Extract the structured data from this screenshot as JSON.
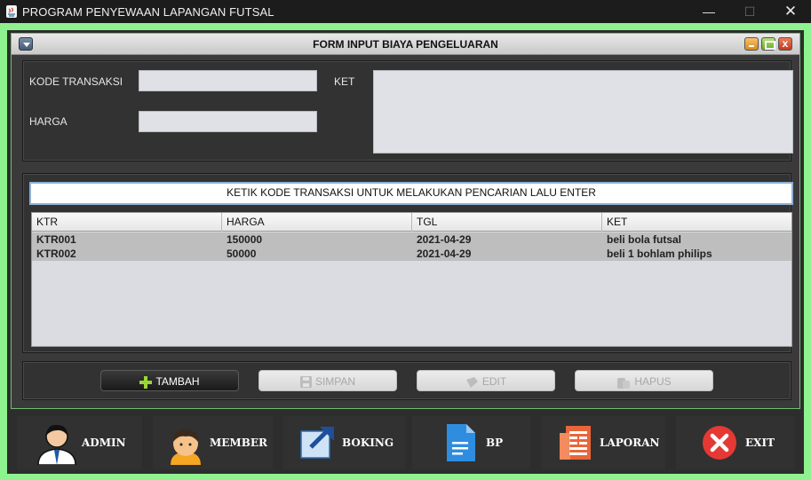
{
  "window": {
    "title": "PROGRAM PENYEWAAN LAPANGAN FUTSAL",
    "minimize": "—",
    "maximize": "☐",
    "close": "✕"
  },
  "form": {
    "title": "FORM INPUT BIAYA PENGELUARAN",
    "close": "x",
    "fields": {
      "kode_label": "KODE TRANSAKSI",
      "kode_value": "",
      "harga_label": "HARGA",
      "harga_value": "",
      "ket_label": "KET",
      "ket_value": ""
    },
    "search": {
      "value": "KETIK KODE TRANSAKSI UNTUK MELAKUKAN PENCARIAN LALU ENTER"
    },
    "table": {
      "columns": [
        "KTR",
        "HARGA",
        "TGL",
        "KET"
      ],
      "rows": [
        [
          "KTR001",
          "150000",
          "2021-04-29",
          "beli bola futsal"
        ],
        [
          "KTR002",
          "50000",
          "2021-04-29",
          "beli 1 bohlam philips"
        ]
      ]
    },
    "buttons": {
      "tambah": "TAMBAH",
      "simpan": "SIMPAN",
      "edit": "EDIT",
      "hapus": "HAPUS"
    }
  },
  "nav": {
    "admin": "ADMIN",
    "member": "MEMBER",
    "boking": "BOKING",
    "bp": "BP",
    "laporan": "LAPORAN",
    "exit": "EXIT"
  },
  "colors": {
    "accent_green": "#8ef28e",
    "tambah_plus": "#9ad63a",
    "exit_red": "#e53935",
    "bp_blue": "#2f8de0",
    "laporan_orange": "#e8663a"
  }
}
